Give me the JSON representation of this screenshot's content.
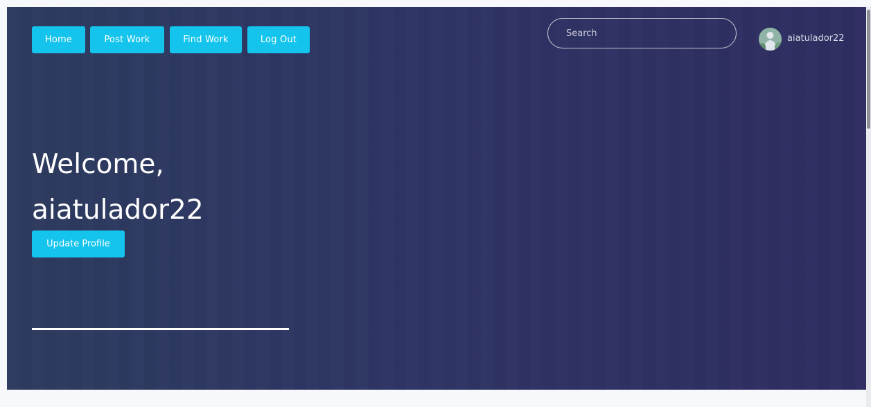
{
  "nav": {
    "home": "Home",
    "post_work": "Post Work",
    "find_work": "Find Work",
    "log_out": "Log Out"
  },
  "search": {
    "placeholder": "Search"
  },
  "user": {
    "username": "aiatulador22",
    "avatar_icon": "user-avatar-icon"
  },
  "hero": {
    "welcome_line1": "Welcome,",
    "welcome_line2": "aiatulador22",
    "update_profile": "Update Profile"
  },
  "colors": {
    "accent": "#14c4ec",
    "hero_background": "#2e3564",
    "page_background": "#f6f8fc"
  }
}
